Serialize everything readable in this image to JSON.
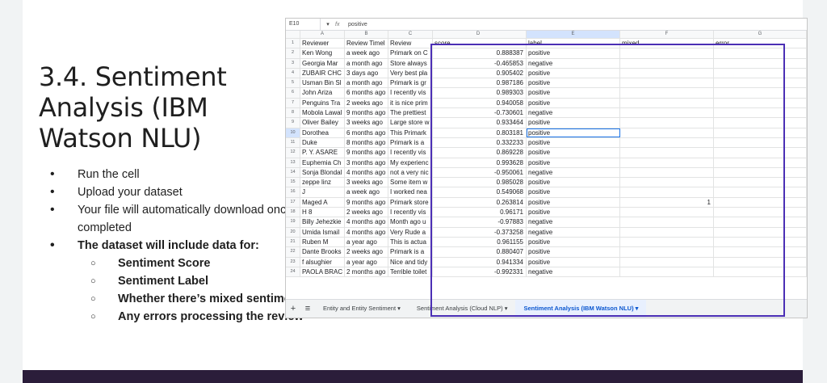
{
  "slide": {
    "title": "3.4. Sentiment Analysis (IBM Watson NLU)",
    "bullets": [
      {
        "text": "Run the cell",
        "bold": false
      },
      {
        "text": "Upload your dataset",
        "bold": false
      },
      {
        "text": "Your file will automatically download once completed",
        "bold": false
      },
      {
        "text": "The dataset will include data for:",
        "bold": true
      }
    ],
    "sub_bullets": [
      "Sentiment Score",
      "Sentiment Label",
      "Whether there’s mixed sentiment",
      "Any errors processing the review"
    ]
  },
  "sheet": {
    "cell_ref": "E10",
    "formula_value": "positive",
    "fx": "fx",
    "columns": [
      "A",
      "B",
      "C",
      "D",
      "E",
      "F",
      "G"
    ],
    "header_row": [
      "Reviewer",
      "Review Timel",
      "Review",
      "score",
      "label",
      "mixed",
      "error"
    ],
    "rows": [
      [
        "Ken Wong",
        "a week ago",
        "Primark on C",
        "0.888387",
        "positive",
        "",
        ""
      ],
      [
        "Georgia Mar",
        "a month ago",
        "Store always",
        "-0.465853",
        "negative",
        "",
        ""
      ],
      [
        "ZUBAIR CHC",
        "3 days ago",
        "Very best pla",
        "0.905402",
        "positive",
        "",
        ""
      ],
      [
        "Usman Bin Sl",
        "a month ago",
        "Primark is gr",
        "0.987186",
        "positive",
        "",
        ""
      ],
      [
        "John Ariza",
        "6 months ago",
        "I recently vis",
        "0.989303",
        "positive",
        "",
        ""
      ],
      [
        "Penguins Tra",
        "2 weeks ago",
        "it is nice prim",
        "0.940058",
        "positive",
        "",
        ""
      ],
      [
        "Mobola Lawal",
        "9 months ago",
        "The prettiest",
        "-0.730601",
        "negative",
        "",
        ""
      ],
      [
        "Oliver Bailey",
        "3 weeks ago",
        "Large store w",
        "0.933464",
        "positive",
        "",
        ""
      ],
      [
        "Dorothea",
        "6 months ago",
        "This Primark",
        "0.803181",
        "positive",
        "",
        ""
      ],
      [
        "Duke",
        "8 months ago",
        "Primark is a",
        "0.332233",
        "positive",
        "",
        ""
      ],
      [
        "P. Y. ASARE",
        "9 months ago",
        "I recently vis",
        "0.869228",
        "positive",
        "",
        ""
      ],
      [
        "Euphemia Ch",
        "3 months ago",
        "My experienc",
        "0.993628",
        "positive",
        "",
        ""
      ],
      [
        "Sonja Blondal",
        "4 months ago",
        "not a very nic",
        "-0.950061",
        "negative",
        "",
        ""
      ],
      [
        "zeppe linz",
        "3 weeks ago",
        "Some item w",
        "0.985028",
        "positive",
        "",
        ""
      ],
      [
        "J",
        "a week ago",
        "I worked nea",
        "0.549068",
        "positive",
        "",
        ""
      ],
      [
        "Maged A",
        "9 months ago",
        "Primark store",
        "0.263814",
        "positive",
        "1",
        ""
      ],
      [
        "H 8",
        "2 weeks ago",
        "I recently vis",
        "0.96171",
        "positive",
        "",
        ""
      ],
      [
        "Billy Jehezkie",
        "4 months ago",
        "Month ago u",
        "-0.97883",
        "negative",
        "",
        ""
      ],
      [
        "Umida Ismail",
        "4 months ago",
        "Very Rude a",
        "-0.373258",
        "negative",
        "",
        ""
      ],
      [
        "Ruben M",
        "a year ago",
        "This is actua",
        "0.961155",
        "positive",
        "",
        ""
      ],
      [
        "Dante Brooks",
        "2 weeks ago",
        "Primark is a",
        "0.880407",
        "positive",
        "",
        ""
      ],
      [
        "f alsughier",
        "a year ago",
        "Nice and tidy",
        "0.941334",
        "positive",
        "",
        ""
      ],
      [
        "PAOLA BRAC",
        "2 months ago",
        "Terrible toilet",
        "-0.992331",
        "negative",
        "",
        ""
      ]
    ],
    "tabs": [
      {
        "label": "Entity and Entity Sentiment ▾",
        "active": false
      },
      {
        "label": "Sentiment Analysis (Cloud NLP) ▾",
        "active": false
      },
      {
        "label": "Sentiment Analysis (IBM Watson NLU) ▾",
        "active": true
      }
    ],
    "add_sheet": "+",
    "all_sheets": "≡"
  },
  "colors": {
    "highlight": "#4b2fb5",
    "footer": "#2b1d3a",
    "active_tab": "#0b57d0"
  }
}
